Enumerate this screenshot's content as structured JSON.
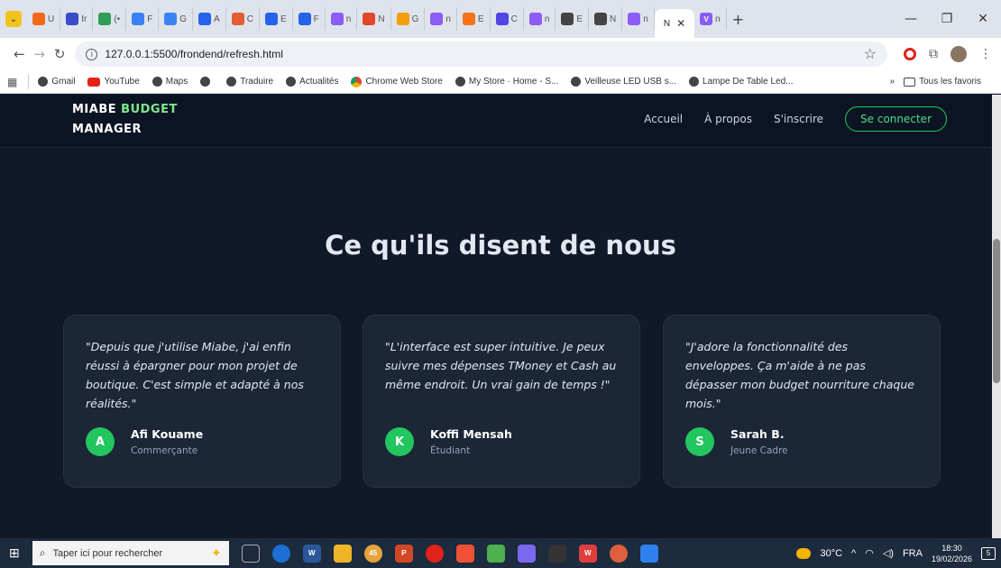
{
  "browser": {
    "tabs": [
      {
        "icon": "infinity-icon",
        "label": "U",
        "color": "#f06a1a"
      },
      {
        "icon": "d-icon",
        "label": "Ir",
        "color": "#3b4cca"
      },
      {
        "icon": "badge-icon",
        "label": "(•",
        "color": "#2e9e57"
      },
      {
        "icon": "play-icon",
        "label": "F",
        "color": "#3b82f6"
      },
      {
        "icon": "gemini-icon",
        "label": "G",
        "color": "#3b82f6"
      },
      {
        "icon": "pen-icon",
        "label": "A",
        "color": "#2563eb"
      },
      {
        "icon": "rainbow-icon",
        "label": "C",
        "color": "#e25c34"
      },
      {
        "icon": "pen-icon",
        "label": "E",
        "color": "#2563eb"
      },
      {
        "icon": "pen-icon",
        "label": "F",
        "color": "#2563eb"
      },
      {
        "icon": "v-icon",
        "label": "n",
        "color": "#8b5cf6"
      },
      {
        "icon": "fire-icon",
        "label": "N",
        "color": "#e2452a"
      },
      {
        "icon": "g-icon",
        "label": "G",
        "color": "#f59e0b"
      },
      {
        "icon": "v-icon",
        "label": "n",
        "color": "#8b5cf6"
      },
      {
        "icon": "cw-icon",
        "label": "E",
        "color": "#f97316"
      },
      {
        "icon": "cw-icon",
        "label": "C",
        "color": "#4f46e5"
      },
      {
        "icon": "v-icon",
        "label": "n",
        "color": "#8b5cf6"
      },
      {
        "icon": "globe-icon",
        "label": "E",
        "color": "#444444"
      },
      {
        "icon": "globe-icon",
        "label": "N",
        "color": "#444444"
      },
      {
        "icon": "v-icon",
        "label": "n",
        "color": "#8b5cf6"
      }
    ],
    "active_tab": {
      "label": "N"
    },
    "last_tab": {
      "label": "n"
    },
    "new_tab_label": "+",
    "url": "127.0.0.1:5500/frondend/refresh.html",
    "bookmarks": [
      {
        "icon": "gmail-icon",
        "label": "Gmail"
      },
      {
        "icon": "youtube-icon",
        "label": "YouTube"
      },
      {
        "icon": "globe-icon",
        "label": "Maps"
      },
      {
        "icon": "globe-icon",
        "label": ""
      },
      {
        "icon": "globe-icon",
        "label": "Traduire"
      },
      {
        "icon": "globe-icon",
        "label": "Actualités"
      },
      {
        "icon": "chrome-web-store-icon",
        "label": "Chrome Web Store"
      },
      {
        "icon": "globe-icon",
        "label": "My Store · Home - S..."
      },
      {
        "icon": "globe-icon",
        "label": "Veilleuse LED USB s..."
      },
      {
        "icon": "globe-icon",
        "label": "Lampe De Table Led..."
      }
    ],
    "bookmarks_more": "»",
    "all_bookmarks": "Tous les favoris"
  },
  "site": {
    "logo_line1": "MIABE",
    "logo_accent": "BUDGET",
    "logo_line2": "MANAGER",
    "nav": [
      "Accueil",
      "À propos",
      "S'inscrire"
    ],
    "login_label": "Se connecter",
    "accent_color": "#22c55e"
  },
  "testimonials": {
    "title": "Ce qu'ils disent de nous",
    "items": [
      {
        "quote": "\"Depuis que j'utilise Miabe, j'ai enfin réussi à épargner pour mon projet de boutique. C'est simple et adapté à nos réalités.\"",
        "initial": "A",
        "name": "Afi Kouame",
        "role": "Commerçante"
      },
      {
        "quote": "\"L'interface est super intuitive. Je peux suivre mes dépenses TMoney et Cash au même endroit. Un vrai gain de temps !\"",
        "initial": "K",
        "name": "Koffi Mensah",
        "role": "Étudiant"
      },
      {
        "quote": "\"J'adore la fonctionnalité des enveloppes. Ça m'aide à ne pas dépasser mon budget nourriture chaque mois.\"",
        "initial": "S",
        "name": "Sarah B.",
        "role": "Jeune Cadre"
      }
    ]
  },
  "taskbar": {
    "search_placeholder": "Taper ici pour rechercher",
    "mail_badge": "45",
    "temperature": "30°C",
    "language": "FRA",
    "time": "18:30",
    "date": "19/02/2026",
    "notification_count": "5"
  }
}
